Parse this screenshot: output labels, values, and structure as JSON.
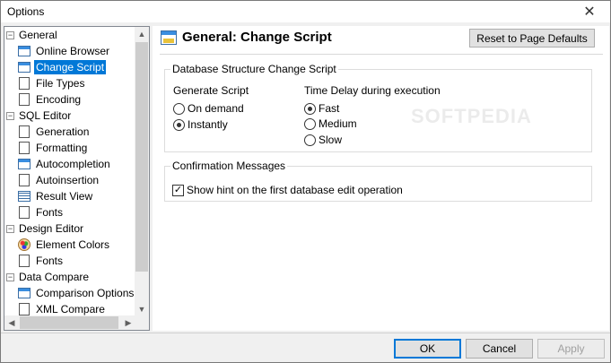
{
  "window": {
    "title": "Options",
    "close_glyph": "✕"
  },
  "tree": {
    "items": [
      {
        "label": "General",
        "level": 0,
        "expander": "−",
        "icon": ""
      },
      {
        "label": "Online Browser",
        "level": 1,
        "icon": "browser-icon"
      },
      {
        "label": "Change Script",
        "level": 1,
        "icon": "sql-script-icon",
        "selected": true
      },
      {
        "label": "File Types",
        "level": 1,
        "icon": "document-icon"
      },
      {
        "label": "Encoding",
        "level": 1,
        "icon": "document-icon"
      },
      {
        "label": "SQL Editor",
        "level": 0,
        "expander": "−",
        "icon": ""
      },
      {
        "label": "Generation",
        "level": 1,
        "icon": "gear-document-icon"
      },
      {
        "label": "Formatting",
        "level": 1,
        "icon": "format-document-icon"
      },
      {
        "label": "Autocompletion",
        "level": 1,
        "icon": "window-icon"
      },
      {
        "label": "Autoinsertion",
        "level": 1,
        "icon": "insert-document-icon"
      },
      {
        "label": "Result View",
        "level": 1,
        "icon": "grid-icon"
      },
      {
        "label": "Fonts",
        "level": 1,
        "icon": "font-document-icon"
      },
      {
        "label": "Design Editor",
        "level": 0,
        "expander": "−",
        "icon": ""
      },
      {
        "label": "Element Colors",
        "level": 1,
        "icon": "palette-icon"
      },
      {
        "label": "Fonts",
        "level": 1,
        "icon": "font-document-icon"
      },
      {
        "label": "Data Compare",
        "level": 0,
        "expander": "−",
        "icon": ""
      },
      {
        "label": "Comparison Options",
        "level": 1,
        "icon": "compare-window-icon"
      },
      {
        "label": "XML Compare",
        "level": 1,
        "icon": "xml-document-icon"
      }
    ],
    "scroll_up": "▲",
    "scroll_down": "▼",
    "scroll_left": "◀",
    "scroll_right": "▶"
  },
  "page": {
    "title": "General: Change Script",
    "reset_button": "Reset to Page Defaults",
    "watermark": "SOFTPEDIA",
    "db_group": {
      "title": "Database Structure Change Script",
      "generate_label": "Generate Script",
      "generate_options": [
        {
          "label": "On demand",
          "checked": false
        },
        {
          "label": "Instantly",
          "checked": true
        }
      ],
      "delay_label": "Time Delay during execution",
      "delay_options": [
        {
          "label": "Fast",
          "checked": true
        },
        {
          "label": "Medium",
          "checked": false
        },
        {
          "label": "Slow",
          "checked": false
        }
      ]
    },
    "confirm_group": {
      "title": "Confirmation Messages",
      "hint_checkbox": {
        "label": "Show hint on the first database edit operation",
        "checked": true,
        "glyph": "✓"
      }
    }
  },
  "footer": {
    "ok": "OK",
    "cancel": "Cancel",
    "apply": "Apply"
  }
}
